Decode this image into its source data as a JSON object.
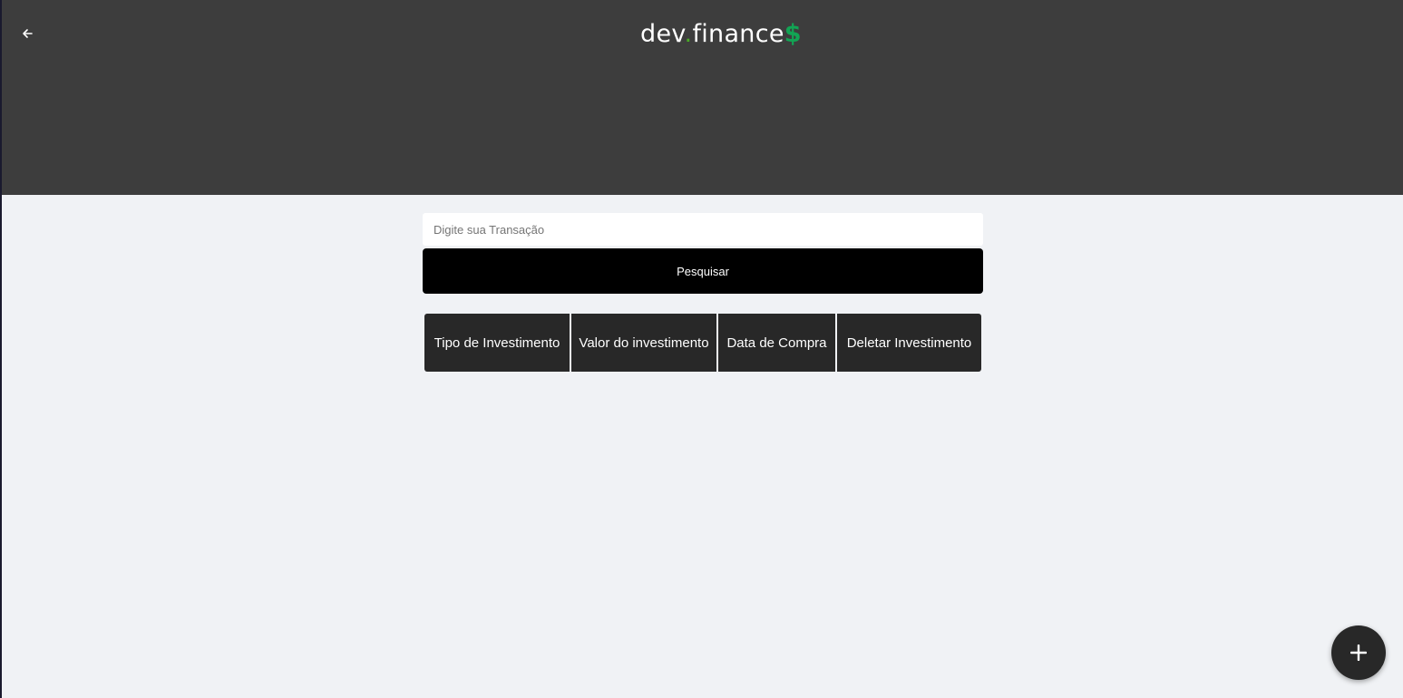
{
  "header": {
    "back_icon": "arrow-left-icon",
    "logo": {
      "part1": "dev",
      "dot": ".",
      "part2": "finance",
      "symbol": "$"
    }
  },
  "search": {
    "placeholder": "Digite sua Transação",
    "value": "",
    "button_label": "Pesquisar"
  },
  "table": {
    "columns": [
      "Tipo de Investimento",
      "Valor do investimento",
      "Data de Compra",
      "Deletar Investimento"
    ],
    "rows": []
  },
  "fab": {
    "icon": "plus-icon"
  },
  "colors": {
    "header_bg": "#3d3d3d",
    "page_bg": "#f0f2f5",
    "accent_green": "#12a454",
    "button_bg": "#000000",
    "table_header_bg": "#282828"
  }
}
